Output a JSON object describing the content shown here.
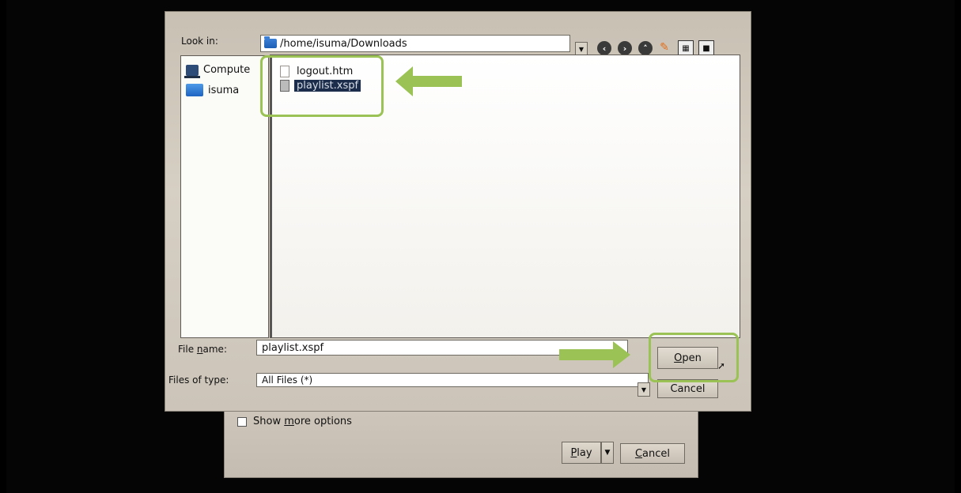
{
  "back_dialog": {
    "show_more_options": {
      "pre": "Show ",
      "mnemonic": "m",
      "post": "ore options"
    },
    "play": {
      "mnemonic": "P",
      "rest": "lay"
    },
    "cancel": {
      "mnemonic": "C",
      "rest": "ancel"
    }
  },
  "file_dialog": {
    "look_in_label": "Look in:",
    "path": "/home/isuma/Downloads",
    "sidebar": {
      "items": [
        {
          "label": "Compute",
          "icon": "computer-icon"
        },
        {
          "label": "isuma",
          "icon": "folder-icon"
        }
      ]
    },
    "files": [
      {
        "name": "logout.htm",
        "selected": false
      },
      {
        "name": "playlist.xspf",
        "selected": true
      }
    ],
    "file_name_label": {
      "pre": "File ",
      "mnemonic": "n",
      "post": "ame:"
    },
    "file_name_value": "playlist.xspf",
    "files_of_type_label": "Files of type:",
    "files_of_type_value": "All Files (*)",
    "open_button": {
      "mnemonic": "O",
      "rest": "pen"
    },
    "cancel_button": "Cancel"
  },
  "colors": {
    "highlight": "#9ac254",
    "selection": "#1b2d4a",
    "folder": "#1e64c2"
  }
}
